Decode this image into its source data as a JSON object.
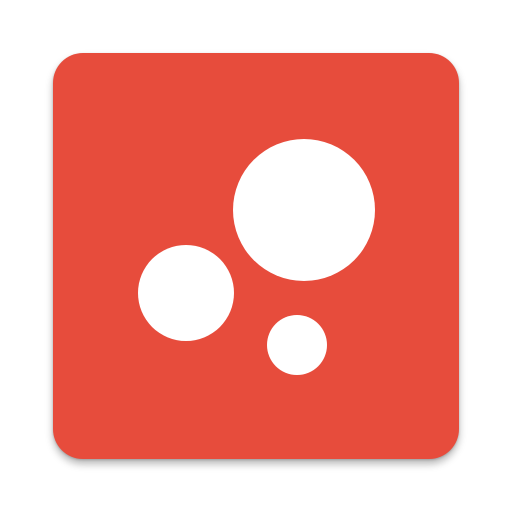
{
  "icon": {
    "name": "bubbles-app-icon",
    "background_color": "#E74C3C",
    "dot_color": "#FFFFFF"
  }
}
